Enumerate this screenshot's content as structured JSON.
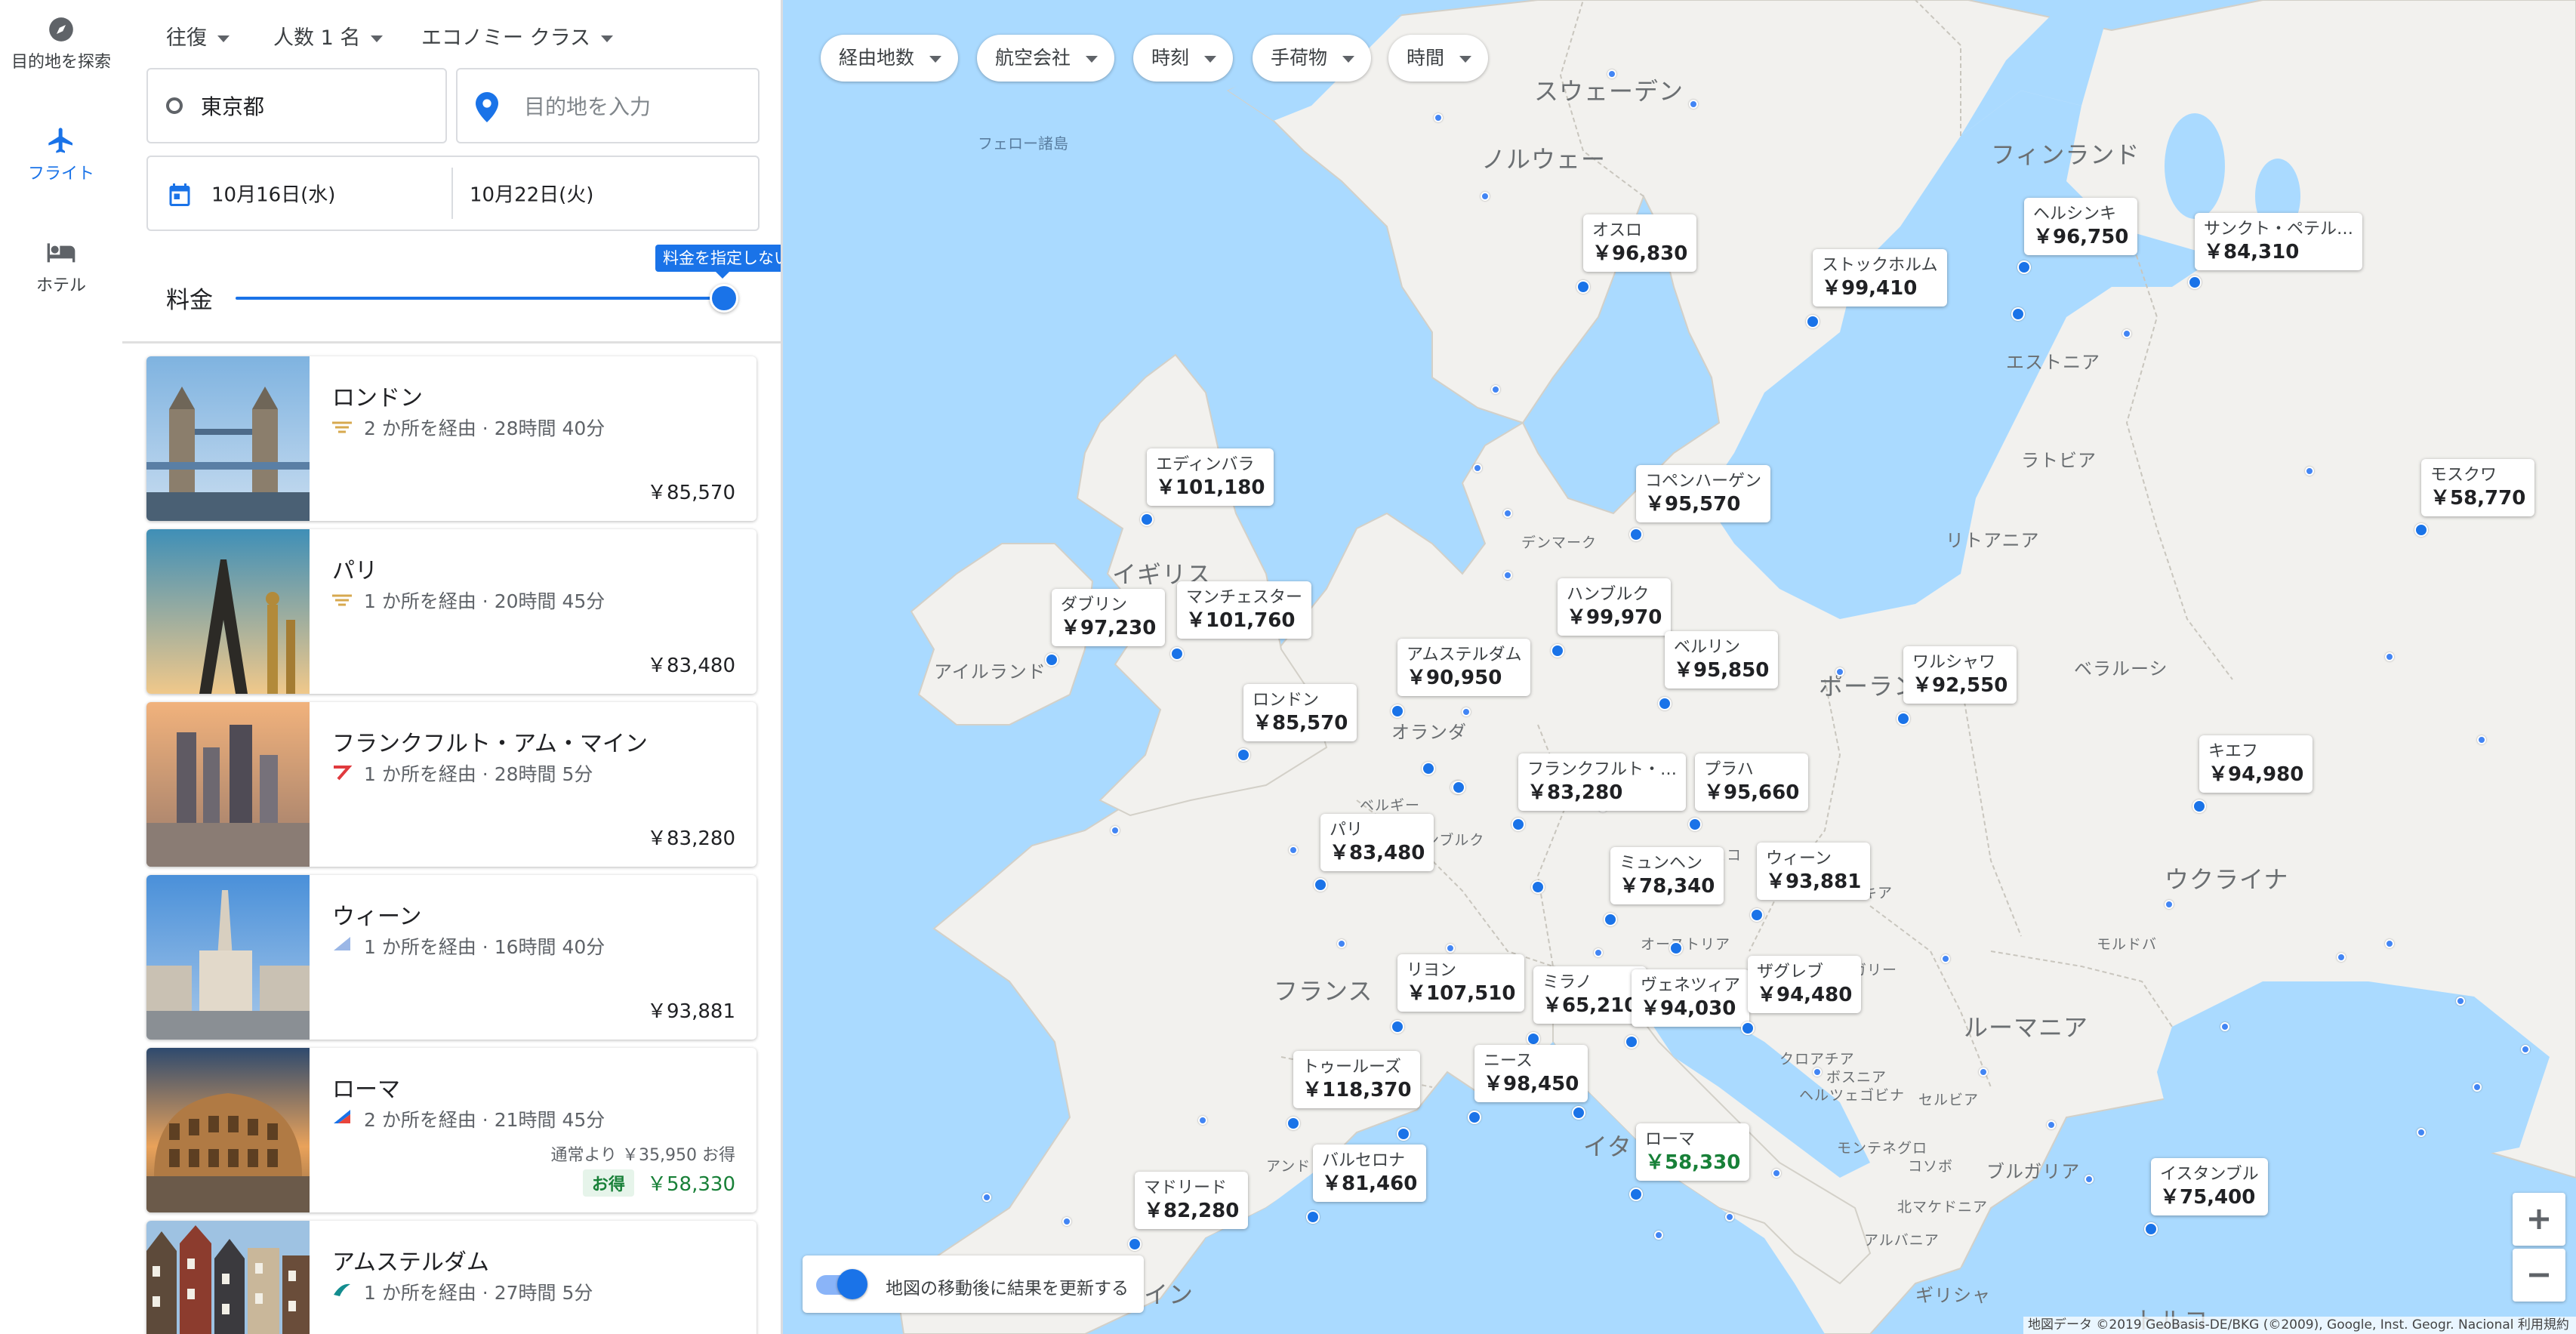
{
  "rail": {
    "explore": "目的地を探索",
    "flights": "フライト",
    "hotels": "ホテル"
  },
  "search": {
    "trip_type": "往復",
    "passengers": "人数 1 名",
    "cabin": "エコノミー クラス",
    "origin": "東京都",
    "destination_placeholder": "目的地を入力",
    "depart_date": "10月16日(水)",
    "return_date": "10月22日(火)",
    "price_label": "料金",
    "price_tooltip": "料金を指定しない"
  },
  "results": [
    {
      "city": "ロンドン",
      "detail": "2 か所を経由 · 28時間 40分",
      "price": "￥85,570",
      "airline": "gold"
    },
    {
      "city": "パリ",
      "detail": "1 か所を経由 · 20時間 45分",
      "price": "￥83,480",
      "airline": "gold"
    },
    {
      "city": "フランクフルト・アム・マイン",
      "detail": "1 か所を経由 · 28時間 5分",
      "price": "￥83,280",
      "airline": "red"
    },
    {
      "city": "ウィーン",
      "detail": "1 か所を経由 · 16時間 40分",
      "price": "￥93,881",
      "airline": "blue"
    },
    {
      "city": "ローマ",
      "detail": "2 か所を経由 · 21時間 45分",
      "usual": "通常より ￥35,950 お得",
      "deal_badge": "お得",
      "price": "￥58,330",
      "airline": "multi"
    },
    {
      "city": "アムステルダム",
      "detail": "1 か所を経由 · 27時間 5分",
      "price": "",
      "airline": "teal"
    }
  ],
  "filters": [
    "経由地数",
    "航空会社",
    "時刻",
    "手荷物",
    "時間"
  ],
  "map_pins": [
    {
      "city": "オスロ",
      "price": "￥96,830"
    },
    {
      "city": "ストックホルム",
      "price": "￥99,410"
    },
    {
      "city": "ヘルシンキ",
      "price": "￥96,750"
    },
    {
      "city": "サンクト・ペテル…",
      "price": "￥84,310"
    },
    {
      "city": "モスクワ",
      "price": "￥58,770"
    },
    {
      "city": "エディンバラ",
      "price": "￥101,180"
    },
    {
      "city": "コペンハーゲン",
      "price": "￥95,570"
    },
    {
      "city": "ダブリン",
      "price": "￥97,230"
    },
    {
      "city": "マンチェスター",
      "price": "￥101,760"
    },
    {
      "city": "ハンブルク",
      "price": "￥99,970"
    },
    {
      "city": "アムステルダム",
      "price": "￥90,950"
    },
    {
      "city": "ベルリン",
      "price": "￥95,850"
    },
    {
      "city": "ワルシャワ",
      "price": "￥92,550"
    },
    {
      "city": "ロンドン",
      "price": "￥85,570"
    },
    {
      "city": "フランクフルト・…",
      "price": "￥83,280"
    },
    {
      "city": "プラハ",
      "price": "￥95,660"
    },
    {
      "city": "キエフ",
      "price": "￥94,980"
    },
    {
      "city": "パリ",
      "price": "￥83,480"
    },
    {
      "city": "ミュンヘン",
      "price": "￥78,340"
    },
    {
      "city": "ウィーン",
      "price": "￥93,881"
    },
    {
      "city": "リヨン",
      "price": "￥107,510"
    },
    {
      "city": "ミラノ",
      "price": "￥65,210"
    },
    {
      "city": "ヴェネツィア",
      "price": "￥94,030"
    },
    {
      "city": "ザグレブ",
      "price": "￥94,480"
    },
    {
      "city": "トゥールーズ",
      "price": "￥118,370"
    },
    {
      "city": "ニース",
      "price": "￥98,450"
    },
    {
      "city": "バルセロナ",
      "price": "￥81,460"
    },
    {
      "city": "ローマ",
      "price": "￥58,330",
      "deal": true
    },
    {
      "city": "マドリード",
      "price": "￥82,280"
    },
    {
      "city": "イスタンブル",
      "price": "￥75,400"
    }
  ],
  "map_labels": {
    "sweden": "スウェーデン",
    "norway": "ノルウェー",
    "finland": "フィンランド",
    "faroe": "フェロー諸島",
    "estonia": "エストニア",
    "latvia": "ラトビア",
    "lithuania": "リトアニア",
    "uk": "イギリス",
    "ireland": "アイルランド",
    "denmark": "デンマーク",
    "netherlands": "オランダ",
    "belgium": "ベルギー",
    "luxembourg": "センブルク",
    "poland": "ポーランド",
    "belarus": "ベラルーシ",
    "ukraine": "ウクライナ",
    "czech": "チェコ",
    "slovakia": "バキア",
    "austria": "オーストリア",
    "hungary": "ガリー",
    "moldova": "モルドバ",
    "france": "フランス",
    "romania": "ルーマニア",
    "croatia": "クロアチア",
    "bosnia": "ボスニア",
    "herzegovina": "ヘルツェゴビナ",
    "serbia": "セルビア",
    "montenegro": "モンテネグロ",
    "kosovo": "コソボ",
    "bulgaria": "ブルガリア",
    "macedonia": "北マケドニア",
    "albania": "アルバニア",
    "italy": "イタ",
    "andorra": "アンド",
    "spain": "イン",
    "greece": "ギリシャ",
    "turkey": "トルコ"
  },
  "map": {
    "toggle_label": "地図の移動後に結果を更新する",
    "zoom_in": "+",
    "zoom_out": "−",
    "footer": "地図データ ©2019 GeoBasis-DE/BKG (©2009), Google, Inst. Geogr. Nacional   利用規約"
  },
  "colors": {
    "accent": "#1a73e8",
    "sea": "#aadaff",
    "land": "#f2f1ee",
    "deal_green": "#188038"
  }
}
